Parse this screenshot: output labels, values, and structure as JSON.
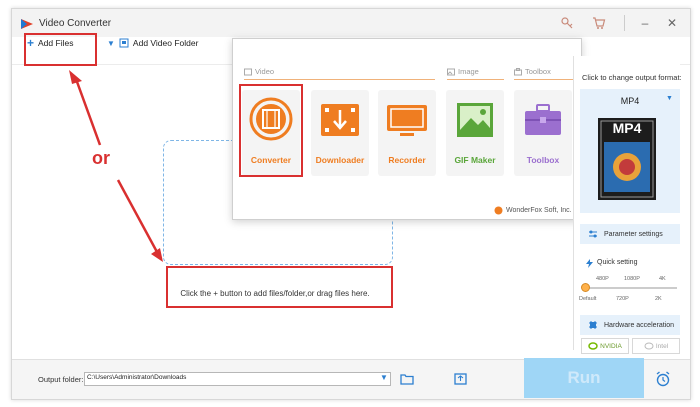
{
  "window": {
    "title": "Video Converter"
  },
  "toolbar": {
    "add_files_label": "Add Files",
    "add_folder_label": "Add Video Folder"
  },
  "annotation": {
    "or_text": "or"
  },
  "drop_zone": {
    "hint": "Click the + button to add files/folder,or drag files here."
  },
  "popup": {
    "sections": [
      {
        "label": "Video"
      },
      {
        "label": "Image"
      },
      {
        "label": "Toolbox"
      }
    ],
    "tiles": [
      {
        "label": "Converter",
        "color": "#ef7d21"
      },
      {
        "label": "Downloader",
        "color": "#ef7d21"
      },
      {
        "label": "Recorder",
        "color": "#ef7d21"
      },
      {
        "label": "GIF Maker",
        "color": "#5aa63a"
      },
      {
        "label": "Toolbox",
        "color": "#9b6fcf"
      }
    ],
    "credit": "WonderFox Soft, Inc."
  },
  "right_panel": {
    "hint": "Click to change output format:",
    "format": "MP4",
    "format_icon_text": "MP4",
    "parameter_settings": "Parameter settings",
    "quick_setting": "Quick setting",
    "quality_top": [
      "480P",
      "1080P",
      "4K"
    ],
    "quality_bottom": [
      "Default",
      "720P",
      "2K"
    ],
    "hardware_acceleration": "Hardware acceleration",
    "gpu_options": [
      "NVIDIA",
      "Intel"
    ]
  },
  "bottom": {
    "output_folder_label": "Output folder:",
    "output_folder_value": "C:\\Users\\Administrator\\Downloads",
    "run_label": "Run"
  },
  "colors": {
    "accent": "#2c7fd0",
    "highlight": "#d93030",
    "run": "#9fd6f6"
  }
}
